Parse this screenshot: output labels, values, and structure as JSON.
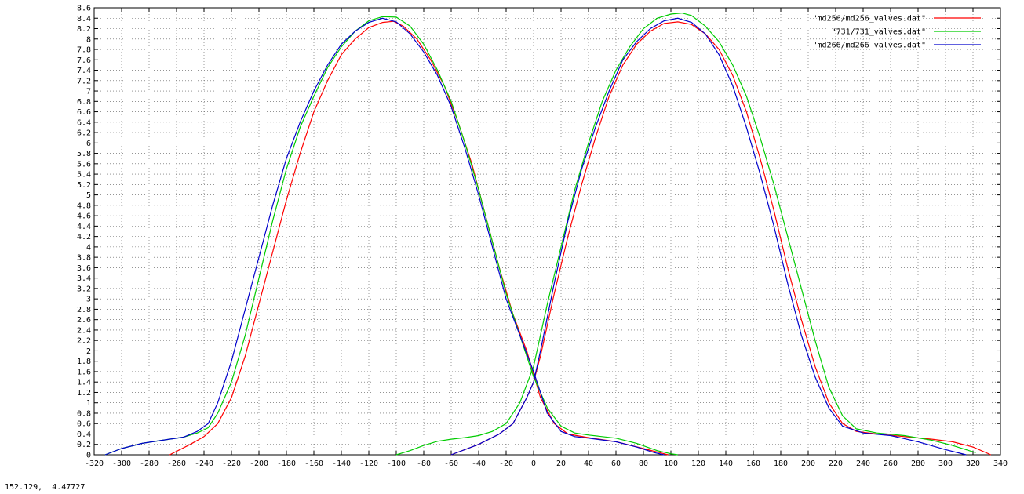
{
  "status": {
    "coords": "152.129,  4.47727"
  },
  "chart_data": {
    "type": "line",
    "title": "",
    "xlabel": "",
    "ylabel": "",
    "xlim": [
      -320,
      340
    ],
    "ylim": [
      0,
      8.6
    ],
    "grid": true,
    "legend_position": "top-right",
    "x_ticks": [
      -320,
      -300,
      -280,
      -260,
      -240,
      -220,
      -200,
      -180,
      -160,
      -140,
      -120,
      -100,
      -80,
      -60,
      -40,
      -20,
      0,
      20,
      40,
      60,
      80,
      100,
      120,
      140,
      160,
      180,
      200,
      220,
      240,
      260,
      280,
      300,
      320,
      340
    ],
    "y_ticks": [
      0,
      0.2,
      0.4,
      0.6,
      0.8,
      1,
      1.2,
      1.4,
      1.6,
      1.8,
      2,
      2.2,
      2.4,
      2.6,
      2.8,
      3,
      3.2,
      3.4,
      3.6,
      3.8,
      4,
      4.2,
      4.4,
      4.6,
      4.8,
      5,
      5.2,
      5.4,
      5.6,
      5.8,
      6,
      6.2,
      6.4,
      6.6,
      6.8,
      7,
      7.2,
      7.4,
      7.6,
      7.8,
      8,
      8.2,
      8.4,
      8.6
    ],
    "series": [
      {
        "name": "\"md256/md256_valves.dat\"",
        "color": "#ff0000",
        "segments": [
          [
            [
              -265,
              0
            ],
            [
              -250,
              0.2
            ],
            [
              -240,
              0.35
            ],
            [
              -230,
              0.6
            ],
            [
              -220,
              1.1
            ],
            [
              -210,
              1.9
            ],
            [
              -200,
              2.9
            ],
            [
              -190,
              3.9
            ],
            [
              -180,
              4.9
            ],
            [
              -170,
              5.8
            ],
            [
              -160,
              6.6
            ],
            [
              -150,
              7.2
            ],
            [
              -140,
              7.7
            ],
            [
              -130,
              8.0
            ],
            [
              -120,
              8.22
            ],
            [
              -110,
              8.32
            ],
            [
              -102,
              8.34
            ],
            [
              -95,
              8.25
            ],
            [
              -85,
              8.0
            ],
            [
              -75,
              7.6
            ],
            [
              -65,
              7.1
            ],
            [
              -55,
              6.4
            ],
            [
              -45,
              5.6
            ],
            [
              -35,
              4.6
            ],
            [
              -25,
              3.6
            ],
            [
              -15,
              2.7
            ],
            [
              -5,
              2.0
            ],
            [
              5,
              1.1
            ],
            [
              15,
              0.6
            ],
            [
              25,
              0.4
            ],
            [
              40,
              0.33
            ],
            [
              60,
              0.25
            ],
            [
              80,
              0.12
            ],
            [
              95,
              0.02
            ],
            [
              98,
              0
            ]
          ],
          [
            [
              -60,
              0
            ],
            [
              -40,
              0.2
            ],
            [
              -25,
              0.4
            ],
            [
              -15,
              0.6
            ],
            [
              -5,
              1.1
            ],
            [
              0,
              1.4
            ],
            [
              5,
              1.9
            ],
            [
              15,
              3.1
            ],
            [
              25,
              4.2
            ],
            [
              35,
              5.2
            ],
            [
              45,
              6.1
            ],
            [
              55,
              6.9
            ],
            [
              65,
              7.5
            ],
            [
              75,
              7.9
            ],
            [
              85,
              8.15
            ],
            [
              95,
              8.3
            ],
            [
              105,
              8.33
            ],
            [
              115,
              8.28
            ],
            [
              125,
              8.1
            ],
            [
              135,
              7.8
            ],
            [
              145,
              7.3
            ],
            [
              155,
              6.6
            ],
            [
              165,
              5.7
            ],
            [
              175,
              4.7
            ],
            [
              185,
              3.6
            ],
            [
              195,
              2.6
            ],
            [
              205,
              1.7
            ],
            [
              215,
              1.0
            ],
            [
              225,
              0.6
            ],
            [
              235,
              0.45
            ],
            [
              250,
              0.4
            ],
            [
              270,
              0.35
            ],
            [
              290,
              0.3
            ],
            [
              305,
              0.25
            ],
            [
              320,
              0.15
            ],
            [
              333,
              0
            ]
          ]
        ]
      },
      {
        "name": "\"731/731_valves.dat\"",
        "color": "#00cc00",
        "segments": [
          [
            [
              -312,
              0
            ],
            [
              -300,
              0.12
            ],
            [
              -285,
              0.22
            ],
            [
              -270,
              0.28
            ],
            [
              -255,
              0.34
            ],
            [
              -245,
              0.42
            ],
            [
              -237,
              0.52
            ],
            [
              -230,
              0.8
            ],
            [
              -220,
              1.4
            ],
            [
              -210,
              2.3
            ],
            [
              -200,
              3.4
            ],
            [
              -190,
              4.5
            ],
            [
              -180,
              5.5
            ],
            [
              -170,
              6.3
            ],
            [
              -160,
              6.9
            ],
            [
              -150,
              7.45
            ],
            [
              -140,
              7.85
            ],
            [
              -130,
              8.15
            ],
            [
              -120,
              8.35
            ],
            [
              -110,
              8.43
            ],
            [
              -100,
              8.42
            ],
            [
              -90,
              8.25
            ],
            [
              -80,
              7.9
            ],
            [
              -70,
              7.4
            ],
            [
              -60,
              6.8
            ],
            [
              -50,
              6.0
            ],
            [
              -40,
              5.1
            ],
            [
              -30,
              4.1
            ],
            [
              -20,
              3.1
            ],
            [
              -10,
              2.3
            ],
            [
              0,
              1.5
            ],
            [
              10,
              0.9
            ],
            [
              20,
              0.55
            ],
            [
              30,
              0.42
            ],
            [
              40,
              0.38
            ],
            [
              60,
              0.32
            ],
            [
              75,
              0.22
            ],
            [
              90,
              0.08
            ],
            [
              100,
              0.02
            ],
            [
              105,
              0
            ]
          ],
          [
            [
              -100,
              0
            ],
            [
              -90,
              0.08
            ],
            [
              -80,
              0.18
            ],
            [
              -70,
              0.26
            ],
            [
              -60,
              0.3
            ],
            [
              -50,
              0.33
            ],
            [
              -40,
              0.37
            ],
            [
              -30,
              0.45
            ],
            [
              -20,
              0.6
            ],
            [
              -10,
              1.0
            ],
            [
              0,
              1.7
            ],
            [
              10,
              2.9
            ],
            [
              20,
              4.0
            ],
            [
              30,
              5.1
            ],
            [
              40,
              6.0
            ],
            [
              50,
              6.8
            ],
            [
              60,
              7.4
            ],
            [
              70,
              7.85
            ],
            [
              80,
              8.2
            ],
            [
              90,
              8.4
            ],
            [
              100,
              8.48
            ],
            [
              108,
              8.5
            ],
            [
              115,
              8.45
            ],
            [
              125,
              8.25
            ],
            [
              135,
              7.95
            ],
            [
              145,
              7.5
            ],
            [
              155,
              6.9
            ],
            [
              165,
              6.1
            ],
            [
              175,
              5.2
            ],
            [
              185,
              4.2
            ],
            [
              195,
              3.2
            ],
            [
              205,
              2.2
            ],
            [
              215,
              1.3
            ],
            [
              225,
              0.75
            ],
            [
              235,
              0.5
            ],
            [
              250,
              0.42
            ],
            [
              270,
              0.37
            ],
            [
              290,
              0.28
            ],
            [
              305,
              0.18
            ],
            [
              322,
              0.04
            ]
          ]
        ]
      },
      {
        "name": "\"md266/md266_valves.dat\"",
        "color": "#0000cc",
        "segments": [
          [
            [
              -312,
              0
            ],
            [
              -300,
              0.12
            ],
            [
              -285,
              0.22
            ],
            [
              -270,
              0.28
            ],
            [
              -255,
              0.34
            ],
            [
              -245,
              0.45
            ],
            [
              -237,
              0.6
            ],
            [
              -230,
              1.0
            ],
            [
              -220,
              1.8
            ],
            [
              -210,
              2.8
            ],
            [
              -200,
              3.8
            ],
            [
              -190,
              4.8
            ],
            [
              -180,
              5.7
            ],
            [
              -170,
              6.4
            ],
            [
              -160,
              7.0
            ],
            [
              -150,
              7.5
            ],
            [
              -140,
              7.9
            ],
            [
              -130,
              8.15
            ],
            [
              -120,
              8.32
            ],
            [
              -110,
              8.4
            ],
            [
              -100,
              8.33
            ],
            [
              -90,
              8.1
            ],
            [
              -80,
              7.75
            ],
            [
              -70,
              7.3
            ],
            [
              -60,
              6.7
            ],
            [
              -50,
              5.9
            ],
            [
              -40,
              5.0
            ],
            [
              -30,
              4.0
            ],
            [
              -20,
              3.0
            ],
            [
              -10,
              2.3
            ],
            [
              0,
              1.6
            ],
            [
              10,
              0.8
            ],
            [
              20,
              0.45
            ],
            [
              30,
              0.35
            ],
            [
              40,
              0.32
            ],
            [
              60,
              0.25
            ],
            [
              75,
              0.15
            ],
            [
              88,
              0.04
            ],
            [
              95,
              0
            ]
          ],
          [
            [
              -60,
              0
            ],
            [
              -40,
              0.2
            ],
            [
              -25,
              0.4
            ],
            [
              -15,
              0.6
            ],
            [
              -5,
              1.1
            ],
            [
              0,
              1.4
            ],
            [
              5,
              2.0
            ],
            [
              15,
              3.3
            ],
            [
              25,
              4.5
            ],
            [
              35,
              5.5
            ],
            [
              45,
              6.3
            ],
            [
              55,
              7.0
            ],
            [
              65,
              7.6
            ],
            [
              75,
              7.95
            ],
            [
              85,
              8.2
            ],
            [
              95,
              8.35
            ],
            [
              105,
              8.4
            ],
            [
              115,
              8.32
            ],
            [
              125,
              8.1
            ],
            [
              135,
              7.7
            ],
            [
              145,
              7.1
            ],
            [
              155,
              6.3
            ],
            [
              165,
              5.4
            ],
            [
              175,
              4.4
            ],
            [
              185,
              3.3
            ],
            [
              195,
              2.3
            ],
            [
              205,
              1.5
            ],
            [
              215,
              0.9
            ],
            [
              225,
              0.55
            ],
            [
              240,
              0.42
            ],
            [
              260,
              0.37
            ],
            [
              280,
              0.25
            ],
            [
              300,
              0.1
            ],
            [
              315,
              0
            ]
          ]
        ]
      }
    ]
  }
}
